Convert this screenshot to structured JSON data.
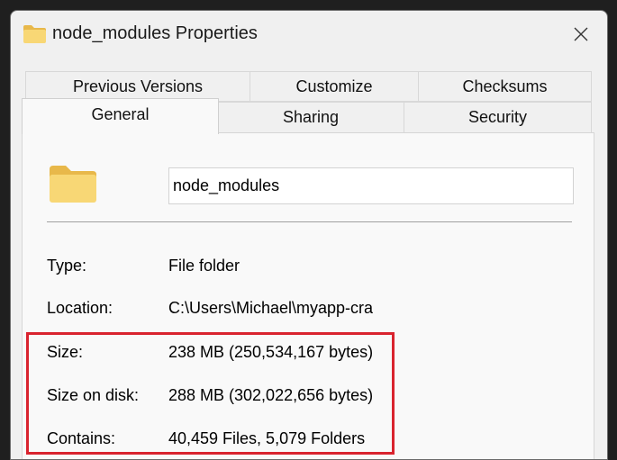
{
  "window": {
    "title": "node_modules Properties",
    "title_icon": "folder-icon",
    "close_icon": "close-icon",
    "folder_color": "#f8d775"
  },
  "tabs": [
    {
      "label": "Previous Versions",
      "active": false
    },
    {
      "label": "Customize",
      "active": false
    },
    {
      "label": "Checksums",
      "active": false
    },
    {
      "label": "General",
      "active": true
    },
    {
      "label": "Sharing",
      "active": false
    },
    {
      "label": "Security",
      "active": false
    }
  ],
  "general": {
    "folder_name": "node_modules",
    "properties": [
      {
        "label": "Type:",
        "value": "File folder"
      },
      {
        "label": "Location:",
        "value": "C:\\Users\\Michael\\myapp-cra"
      },
      {
        "label": "Size:",
        "value": "238 MB (250,534,167 bytes)"
      },
      {
        "label": "Size on disk:",
        "value": "288 MB (302,022,656 bytes)"
      },
      {
        "label": "Contains:",
        "value": "40,459 Files, 5,079 Folders"
      }
    ],
    "highlight_color": "#d9232e"
  }
}
